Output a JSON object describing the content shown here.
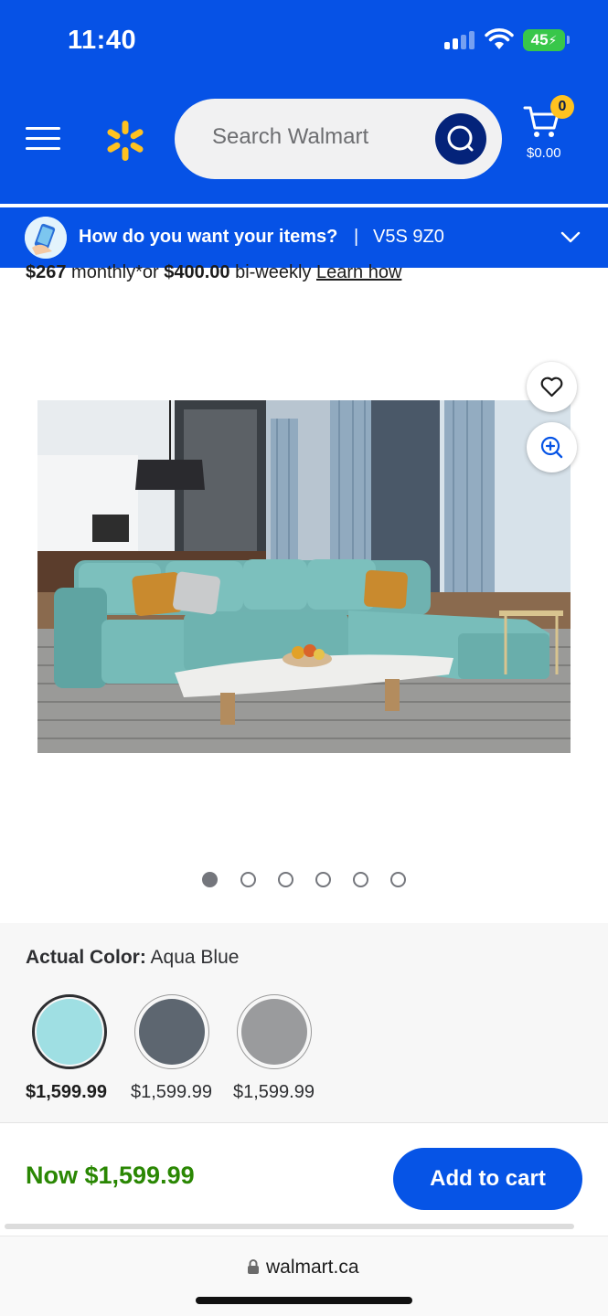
{
  "status_bar": {
    "time": "11:40",
    "battery": "45"
  },
  "header": {
    "menu_icon": "hamburger-menu-icon",
    "logo_icon": "walmart-spark-icon",
    "search_placeholder": "Search Walmart",
    "search_icon": "search-icon",
    "cart_icon": "cart-icon",
    "cart_count": "0",
    "cart_total": "$0.00",
    "brand_color": "#0652e6",
    "spark_color": "#ffc220"
  },
  "delivery": {
    "question": "How do you want your items?",
    "separator": "|",
    "postal_code": "V5S 9Z0",
    "chevron_icon": "chevron-down-icon"
  },
  "financing": {
    "monthly_amount": "$267",
    "monthly_text": " monthly*or ",
    "biweekly_amount": "$400.00",
    "biweekly_text": " bi-weekly ",
    "learn_link": "Learn how"
  },
  "product_image": {
    "subject": "aqua blue sectional sofa in living room",
    "favorite_icon": "heart-icon",
    "zoom_icon": "zoom-in-icon"
  },
  "carousel": {
    "total": 6,
    "active_index": 0
  },
  "color_selector": {
    "label": "Actual Color:",
    "value": "Aqua Blue",
    "swatches": [
      {
        "name": "Aqua Blue",
        "color": "#9fdfe3",
        "price": "$1,599.99",
        "selected": true
      },
      {
        "name": "Dark Grey",
        "color": "#5d6670",
        "price": "$1,599.99",
        "selected": false
      },
      {
        "name": "Light Grey",
        "color": "#9a9b9d",
        "price": "$1,599.99",
        "selected": false
      }
    ]
  },
  "buy_bar": {
    "now_price": "Now $1,599.99",
    "add_to_cart": "Add to cart",
    "price_color": "#2a8703",
    "button_color": "#0654e6"
  },
  "browser": {
    "lock_icon": "lock-icon",
    "url": "walmart.ca"
  }
}
